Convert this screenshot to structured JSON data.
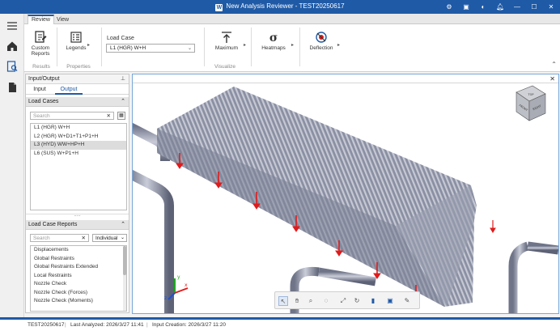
{
  "window": {
    "title": "New Analysis Reviewer - TEST20250617",
    "logo": "analysis-reviewer-logo"
  },
  "ribbon": {
    "tabs": [
      "Review",
      "View"
    ],
    "active_tab": "Review",
    "groups": {
      "results": {
        "label": "Results",
        "buttons": [
          {
            "label_line1": "Custom",
            "label_line2": "Reports",
            "icon": "custom-reports-icon"
          }
        ]
      },
      "properties": {
        "label": "Properties",
        "buttons": [
          {
            "label": "Legends",
            "icon": "legends-icon"
          }
        ]
      },
      "visualize": {
        "label": "Visualize",
        "load_case_label": "Load Case",
        "load_case_value": "L1 (HGR) W+H",
        "buttons": [
          {
            "label": "Maximum",
            "icon": "maximum-icon"
          },
          {
            "label": "Heatmaps",
            "icon": "heatmaps-icon"
          },
          {
            "label": "Deflection",
            "icon": "deflection-icon"
          }
        ]
      }
    }
  },
  "panel": {
    "title": "Input/Output",
    "tabs": [
      "Input",
      "Output"
    ],
    "active_tab": "Output",
    "load_cases": {
      "header": "Load Cases",
      "search_placeholder": "Search",
      "items": [
        "L1 (HGR) W+H",
        "L2 (HGR) W+D1+T1+P1+H",
        "L3 (HYD) WW+HP+H",
        "L6 (SUS) W+P1+H"
      ],
      "selected_index": 2
    },
    "reports": {
      "header": "Load Case Reports",
      "search_placeholder": "Search",
      "mode": "Individual",
      "items": [
        "Displacements",
        "Global Restraints",
        "Global Restraints Extended",
        "Local Restraints",
        "Nozzle Check",
        "Nozzle Check (Forces)",
        "Nozzle Check (Moments)"
      ]
    }
  },
  "view_cube": {
    "top": "TOP",
    "front": "FRONT",
    "right": "RIGHT"
  },
  "axes": {
    "x": "x",
    "y": "y",
    "z": "z"
  },
  "status": {
    "model": "TEST20250617",
    "last_analyzed": "Last Analyzed: 2026/3/27 11:41",
    "input_creation": "Input Creation: 2026/3/27 11:20"
  },
  "colors": {
    "accent": "#1f5aa6",
    "pipe": "#8e93a5",
    "arrow": "#e01b1b"
  }
}
